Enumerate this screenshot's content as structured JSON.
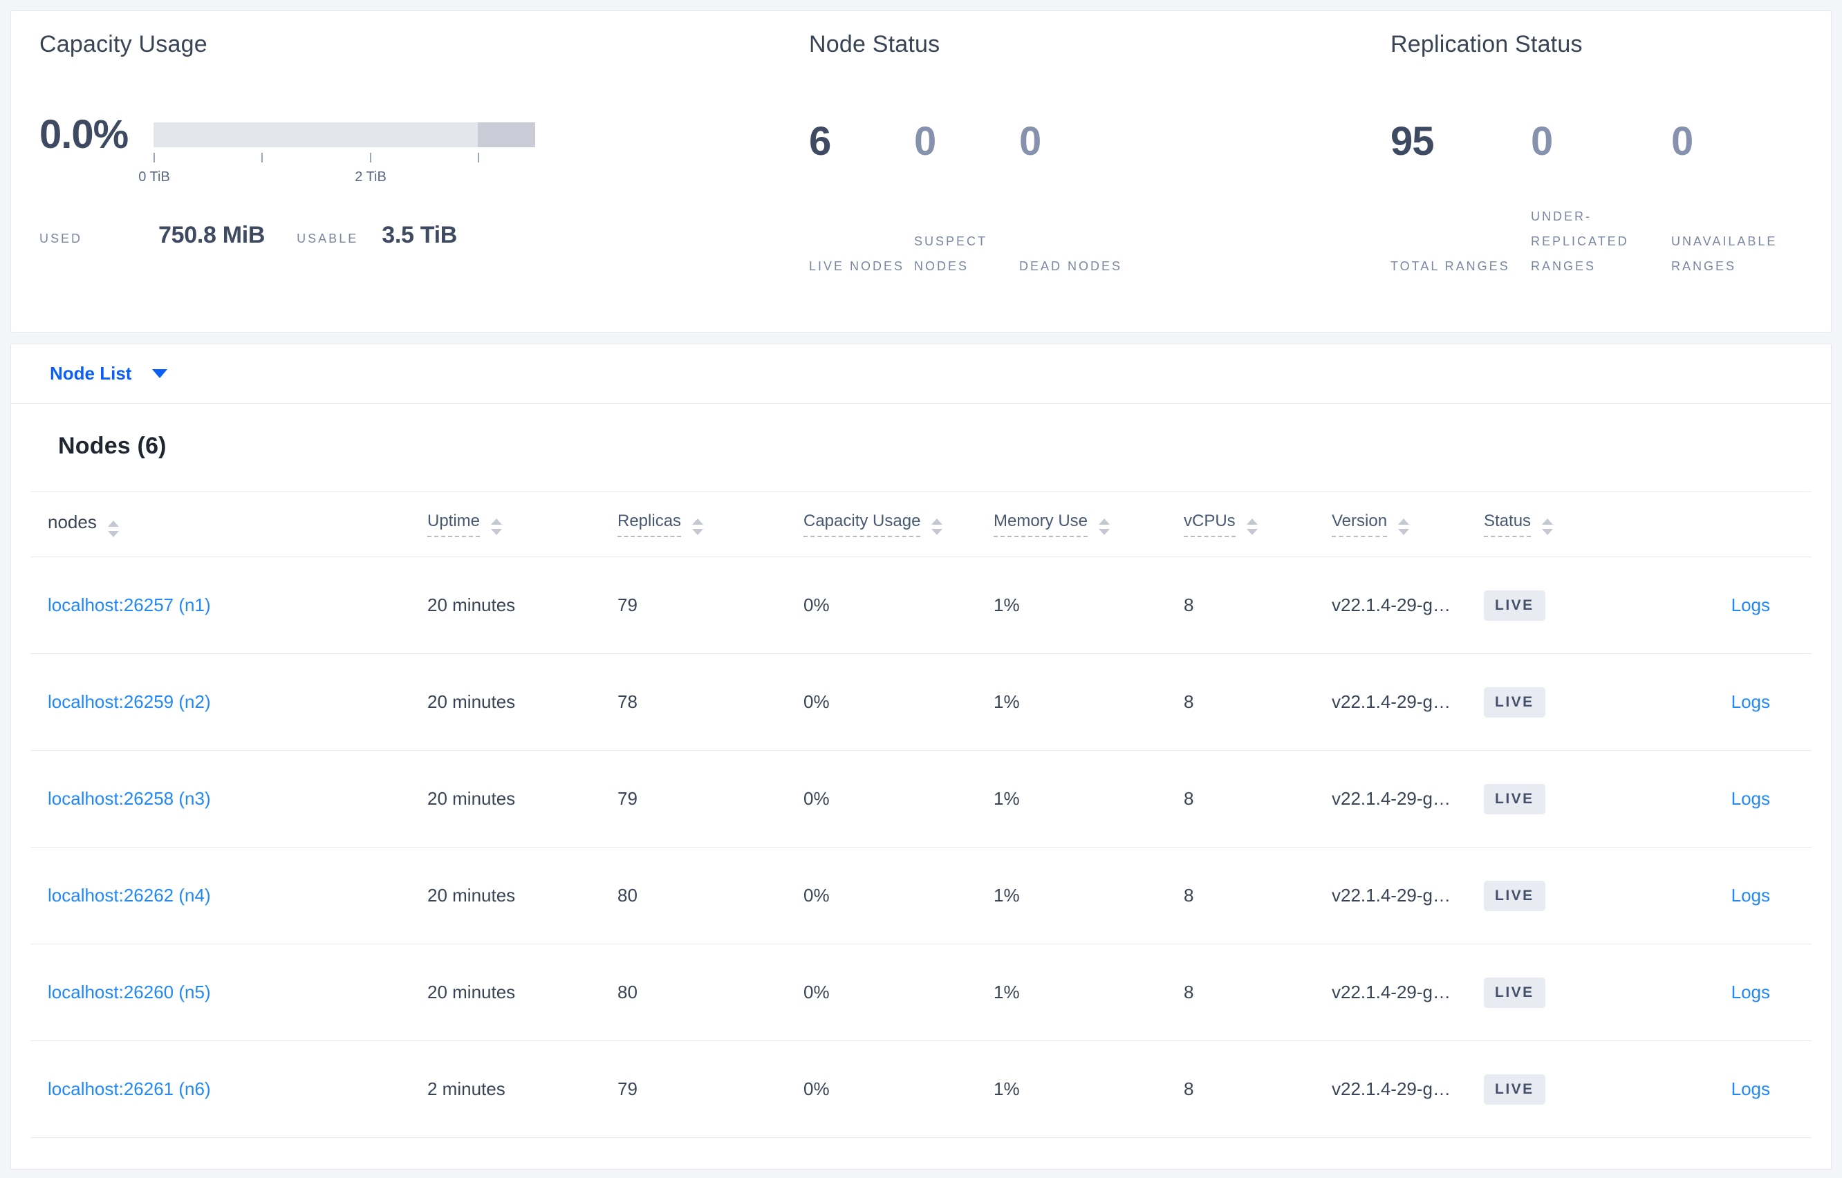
{
  "colors": {
    "page_background": "#f4f5f9",
    "card_background": "#ffffff",
    "dark_text": "#394455",
    "muted_caps_label": "#7a86a1",
    "dim_stat_number": "#8691ae",
    "dropdown_accent_blue": "#0d5ef5",
    "link_blue": "#2289f4",
    "bar_light": "#e3e6ed",
    "bar_dark": "#c9ccd7",
    "live_badge_bg": "#e8ebf2",
    "live_badge_text": "#44506a",
    "row_divider": "#e7e9ee"
  },
  "summary": {
    "capacity": {
      "title": "Capacity Usage",
      "percent": "0.0%",
      "tick_labels": [
        "0 TiB",
        "2 TiB"
      ],
      "used_label": "USED",
      "used_value": "750.8 MiB",
      "usable_label": "USABLE",
      "usable_value": "3.5 TiB",
      "bar": {
        "used_fraction": 0.0,
        "dark_segment_fraction": 0.15
      }
    },
    "node_status": {
      "title": "Node Status",
      "stats": [
        {
          "value": "6",
          "label": "LIVE NODES",
          "emphasis": true
        },
        {
          "value": "0",
          "label": "SUSPECT NODES",
          "emphasis": false
        },
        {
          "value": "0",
          "label": "DEAD NODES",
          "emphasis": false
        }
      ]
    },
    "replication_status": {
      "title": "Replication Status",
      "stats": [
        {
          "value": "95",
          "label": "TOTAL RANGES",
          "emphasis": true
        },
        {
          "value": "0",
          "label": "UNDER-REPLICATED RANGES",
          "emphasis": false
        },
        {
          "value": "0",
          "label": "UNAVAILABLE RANGES",
          "emphasis": false
        }
      ]
    }
  },
  "node_list": {
    "dropdown_label": "Node List",
    "heading": "Nodes (6)",
    "columns": [
      {
        "label": "nodes"
      },
      {
        "label": "Uptime"
      },
      {
        "label": "Replicas"
      },
      {
        "label": "Capacity Usage"
      },
      {
        "label": "Memory Use"
      },
      {
        "label": "vCPUs"
      },
      {
        "label": "Version"
      },
      {
        "label": "Status"
      }
    ],
    "rows": [
      {
        "node": "localhost:26257 (n1)",
        "uptime": "20 minutes",
        "replicas": "79",
        "capacity_usage": "0%",
        "memory_use": "1%",
        "vcpus": "8",
        "version": "v22.1.4-29-g…",
        "status": "LIVE",
        "logs": "Logs"
      },
      {
        "node": "localhost:26259 (n2)",
        "uptime": "20 minutes",
        "replicas": "78",
        "capacity_usage": "0%",
        "memory_use": "1%",
        "vcpus": "8",
        "version": "v22.1.4-29-g…",
        "status": "LIVE",
        "logs": "Logs"
      },
      {
        "node": "localhost:26258 (n3)",
        "uptime": "20 minutes",
        "replicas": "79",
        "capacity_usage": "0%",
        "memory_use": "1%",
        "vcpus": "8",
        "version": "v22.1.4-29-g…",
        "status": "LIVE",
        "logs": "Logs"
      },
      {
        "node": "localhost:26262 (n4)",
        "uptime": "20 minutes",
        "replicas": "80",
        "capacity_usage": "0%",
        "memory_use": "1%",
        "vcpus": "8",
        "version": "v22.1.4-29-g…",
        "status": "LIVE",
        "logs": "Logs"
      },
      {
        "node": "localhost:26260 (n5)",
        "uptime": "20 minutes",
        "replicas": "80",
        "capacity_usage": "0%",
        "memory_use": "1%",
        "vcpus": "8",
        "version": "v22.1.4-29-g…",
        "status": "LIVE",
        "logs": "Logs"
      },
      {
        "node": "localhost:26261 (n6)",
        "uptime": "2 minutes",
        "replicas": "79",
        "capacity_usage": "0%",
        "memory_use": "1%",
        "vcpus": "8",
        "version": "v22.1.4-29-g…",
        "status": "LIVE",
        "logs": "Logs"
      }
    ]
  }
}
